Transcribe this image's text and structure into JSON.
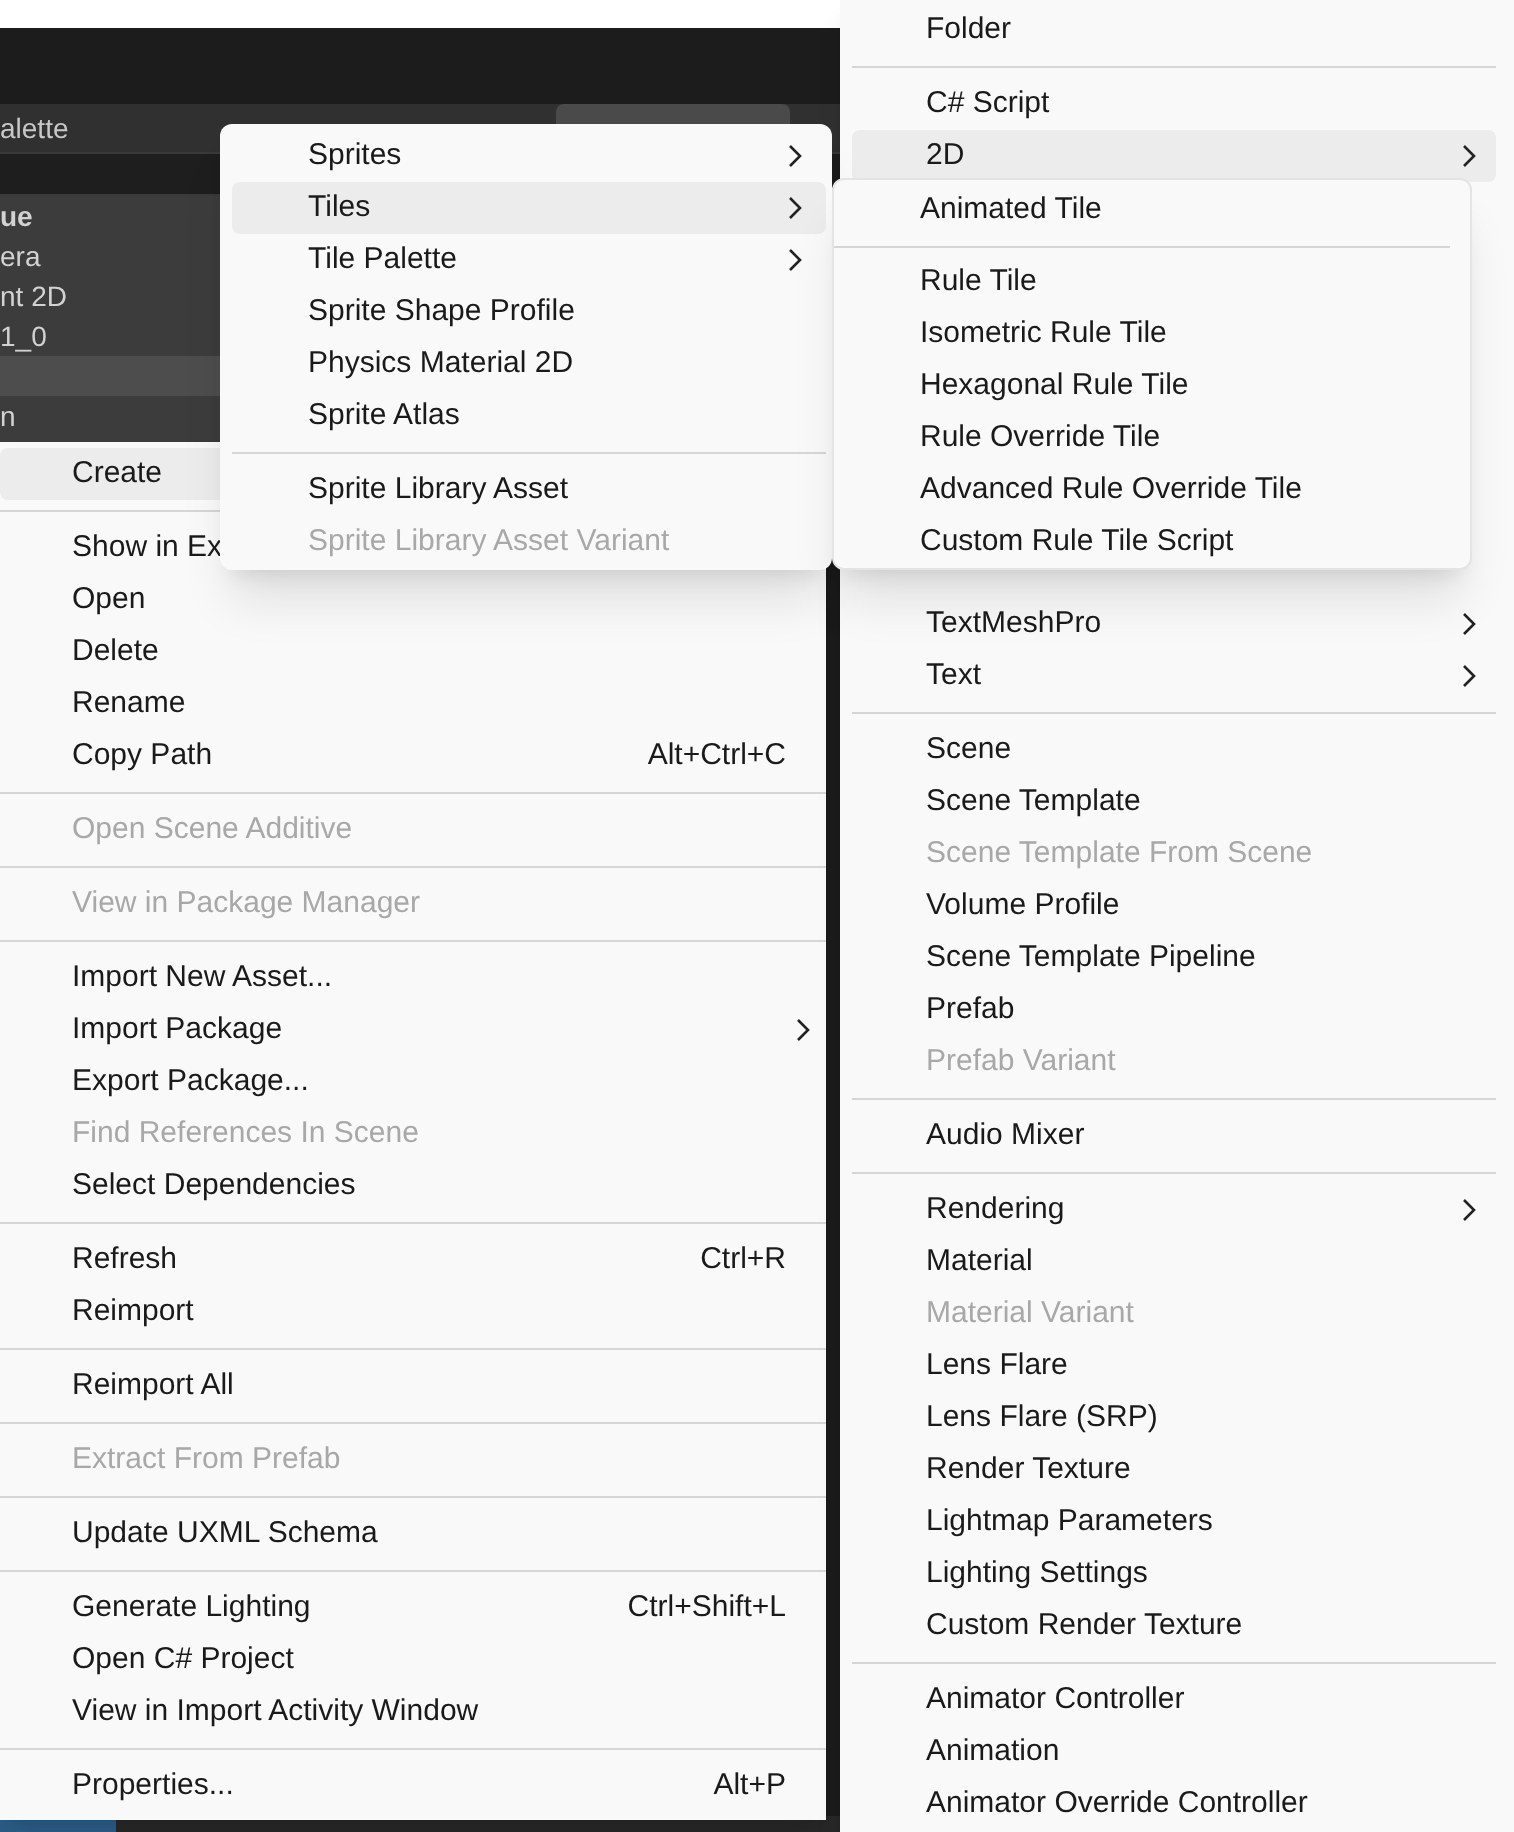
{
  "background_panel": {
    "tab_title": "alette",
    "rows": [
      {
        "label": "ue",
        "kind": "header"
      },
      {
        "label": "era",
        "kind": "item"
      },
      {
        "label": "nt 2D",
        "kind": "item"
      },
      {
        "label": "1_0",
        "kind": "item"
      },
      {
        "label": "n",
        "kind": "item"
      }
    ]
  },
  "context_menu": {
    "items": [
      {
        "kind": "item",
        "label": "Create",
        "selected": true,
        "disabled": false,
        "submenu": false
      },
      {
        "kind": "separator"
      },
      {
        "kind": "item",
        "label": "Show in Ex",
        "selected": false,
        "disabled": false,
        "submenu": false
      },
      {
        "kind": "item",
        "label": "Open",
        "selected": false,
        "disabled": false,
        "submenu": false
      },
      {
        "kind": "item",
        "label": "Delete",
        "selected": false,
        "disabled": false,
        "submenu": false
      },
      {
        "kind": "item",
        "label": "Rename",
        "selected": false,
        "disabled": false,
        "submenu": false
      },
      {
        "kind": "item",
        "label": "Copy Path",
        "shortcut": "Alt+Ctrl+C",
        "selected": false,
        "disabled": false,
        "submenu": false
      },
      {
        "kind": "separator"
      },
      {
        "kind": "item",
        "label": "Open Scene Additive",
        "selected": false,
        "disabled": true,
        "submenu": false
      },
      {
        "kind": "separator"
      },
      {
        "kind": "item",
        "label": "View in Package Manager",
        "selected": false,
        "disabled": true,
        "submenu": false
      },
      {
        "kind": "separator"
      },
      {
        "kind": "item",
        "label": "Import New Asset...",
        "selected": false,
        "disabled": false,
        "submenu": false
      },
      {
        "kind": "item",
        "label": "Import Package",
        "selected": false,
        "disabled": false,
        "submenu": true
      },
      {
        "kind": "item",
        "label": "Export Package...",
        "selected": false,
        "disabled": false,
        "submenu": false
      },
      {
        "kind": "item",
        "label": "Find References In Scene",
        "selected": false,
        "disabled": true,
        "submenu": false
      },
      {
        "kind": "item",
        "label": "Select Dependencies",
        "selected": false,
        "disabled": false,
        "submenu": false
      },
      {
        "kind": "separator"
      },
      {
        "kind": "item",
        "label": "Refresh",
        "shortcut": "Ctrl+R",
        "selected": false,
        "disabled": false,
        "submenu": false
      },
      {
        "kind": "item",
        "label": "Reimport",
        "selected": false,
        "disabled": false,
        "submenu": false
      },
      {
        "kind": "separator"
      },
      {
        "kind": "item",
        "label": "Reimport All",
        "selected": false,
        "disabled": false,
        "submenu": false
      },
      {
        "kind": "separator"
      },
      {
        "kind": "item",
        "label": "Extract From Prefab",
        "selected": false,
        "disabled": true,
        "submenu": false
      },
      {
        "kind": "separator"
      },
      {
        "kind": "item",
        "label": "Update UXML Schema",
        "selected": false,
        "disabled": false,
        "submenu": false
      },
      {
        "kind": "separator"
      },
      {
        "kind": "item",
        "label": "Generate Lighting",
        "shortcut": "Ctrl+Shift+L",
        "selected": false,
        "disabled": false,
        "submenu": false
      },
      {
        "kind": "item",
        "label": "Open C# Project",
        "selected": false,
        "disabled": false,
        "submenu": false
      },
      {
        "kind": "item",
        "label": "View in Import Activity Window",
        "selected": false,
        "disabled": false,
        "submenu": false
      },
      {
        "kind": "separator"
      },
      {
        "kind": "item",
        "label": "Properties...",
        "shortcut": "Alt+P",
        "selected": false,
        "disabled": false,
        "submenu": false
      }
    ]
  },
  "create_menu": {
    "upper": [
      {
        "kind": "item",
        "label": "Folder",
        "selected": false,
        "disabled": false,
        "submenu": false
      },
      {
        "kind": "separator"
      },
      {
        "kind": "item",
        "label": "C# Script",
        "selected": false,
        "disabled": false,
        "submenu": false
      },
      {
        "kind": "item",
        "label": "2D",
        "selected": true,
        "disabled": false,
        "submenu": true
      }
    ],
    "lower": [
      {
        "kind": "item",
        "label": "TextMeshPro",
        "selected": false,
        "disabled": false,
        "submenu": true
      },
      {
        "kind": "item",
        "label": "Text",
        "selected": false,
        "disabled": false,
        "submenu": true
      },
      {
        "kind": "separator"
      },
      {
        "kind": "item",
        "label": "Scene",
        "selected": false,
        "disabled": false,
        "submenu": false
      },
      {
        "kind": "item",
        "label": "Scene Template",
        "selected": false,
        "disabled": false,
        "submenu": false
      },
      {
        "kind": "item",
        "label": "Scene Template From Scene",
        "selected": false,
        "disabled": true,
        "submenu": false
      },
      {
        "kind": "item",
        "label": "Volume Profile",
        "selected": false,
        "disabled": false,
        "submenu": false
      },
      {
        "kind": "item",
        "label": "Scene Template Pipeline",
        "selected": false,
        "disabled": false,
        "submenu": false
      },
      {
        "kind": "item",
        "label": "Prefab",
        "selected": false,
        "disabled": false,
        "submenu": false
      },
      {
        "kind": "item",
        "label": "Prefab Variant",
        "selected": false,
        "disabled": true,
        "submenu": false
      },
      {
        "kind": "separator"
      },
      {
        "kind": "item",
        "label": "Audio Mixer",
        "selected": false,
        "disabled": false,
        "submenu": false
      },
      {
        "kind": "separator"
      },
      {
        "kind": "item",
        "label": "Rendering",
        "selected": false,
        "disabled": false,
        "submenu": true
      },
      {
        "kind": "item",
        "label": "Material",
        "selected": false,
        "disabled": false,
        "submenu": false
      },
      {
        "kind": "item",
        "label": "Material Variant",
        "selected": false,
        "disabled": true,
        "submenu": false
      },
      {
        "kind": "item",
        "label": "Lens Flare",
        "selected": false,
        "disabled": false,
        "submenu": false
      },
      {
        "kind": "item",
        "label": "Lens Flare (SRP)",
        "selected": false,
        "disabled": false,
        "submenu": false
      },
      {
        "kind": "item",
        "label": "Render Texture",
        "selected": false,
        "disabled": false,
        "submenu": false
      },
      {
        "kind": "item",
        "label": "Lightmap Parameters",
        "selected": false,
        "disabled": false,
        "submenu": false
      },
      {
        "kind": "item",
        "label": "Lighting Settings",
        "selected": false,
        "disabled": false,
        "submenu": false
      },
      {
        "kind": "item",
        "label": "Custom Render Texture",
        "selected": false,
        "disabled": false,
        "submenu": false
      },
      {
        "kind": "separator"
      },
      {
        "kind": "item",
        "label": "Animator Controller",
        "selected": false,
        "disabled": false,
        "submenu": false
      },
      {
        "kind": "item",
        "label": "Animation",
        "selected": false,
        "disabled": false,
        "submenu": false
      },
      {
        "kind": "item",
        "label": "Animator Override Controller",
        "selected": false,
        "disabled": false,
        "submenu": false
      }
    ]
  },
  "submenu_2d": {
    "items": [
      {
        "kind": "item",
        "label": "Sprites",
        "selected": false,
        "disabled": false,
        "submenu": true
      },
      {
        "kind": "item",
        "label": "Tiles",
        "selected": true,
        "disabled": false,
        "submenu": true
      },
      {
        "kind": "item",
        "label": "Tile Palette",
        "selected": false,
        "disabled": false,
        "submenu": true
      },
      {
        "kind": "item",
        "label": "Sprite Shape Profile",
        "selected": false,
        "disabled": false,
        "submenu": false
      },
      {
        "kind": "item",
        "label": "Physics Material 2D",
        "selected": false,
        "disabled": false,
        "submenu": false
      },
      {
        "kind": "item",
        "label": "Sprite Atlas",
        "selected": false,
        "disabled": false,
        "submenu": false
      },
      {
        "kind": "separator"
      },
      {
        "kind": "item",
        "label": "Sprite Library Asset",
        "selected": false,
        "disabled": false,
        "submenu": false
      },
      {
        "kind": "item",
        "label": "Sprite Library Asset Variant",
        "selected": false,
        "disabled": true,
        "submenu": false
      }
    ]
  },
  "submenu_tiles": {
    "items": [
      {
        "kind": "item",
        "label": "Animated Tile",
        "selected": false,
        "disabled": false,
        "submenu": false
      },
      {
        "kind": "separator"
      },
      {
        "kind": "item",
        "label": "Rule Tile",
        "selected": false,
        "disabled": false,
        "submenu": false
      },
      {
        "kind": "item",
        "label": "Isometric Rule Tile",
        "selected": false,
        "disabled": false,
        "submenu": false
      },
      {
        "kind": "item",
        "label": "Hexagonal Rule Tile",
        "selected": false,
        "disabled": false,
        "submenu": false
      },
      {
        "kind": "item",
        "label": "Rule Override Tile",
        "selected": false,
        "disabled": false,
        "submenu": false
      },
      {
        "kind": "item",
        "label": "Advanced Rule Override Tile",
        "selected": false,
        "disabled": false,
        "submenu": false
      },
      {
        "kind": "item",
        "label": "Custom Rule Tile Script",
        "selected": false,
        "disabled": false,
        "submenu": false
      }
    ]
  }
}
